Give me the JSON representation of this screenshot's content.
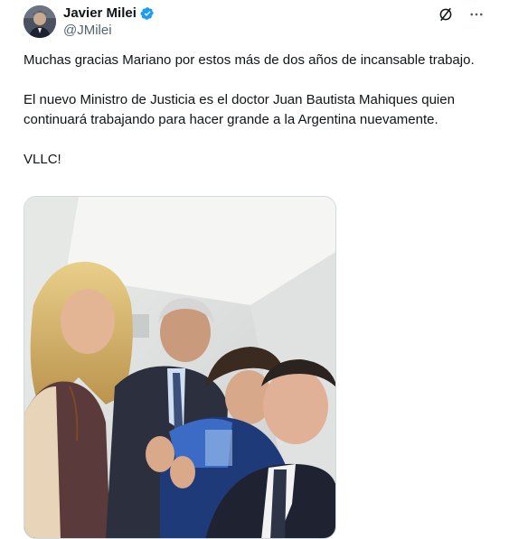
{
  "author": {
    "name": "Javier Milei",
    "handle": "@JMilei",
    "verified": true,
    "avatar_icon": "user-avatar"
  },
  "actions": {
    "grok_icon": "grok-icon",
    "more_icon": "more-options-icon"
  },
  "tweet": {
    "paragraphs": [
      "Muchas gracias Mariano por estos más de dos años de incansable trabajo.",
      "El nuevo Ministro de Justicia es el doctor Juan Bautista Mahiques quien continuará trabajando para hacer grande a la Argentina nuevamente.",
      "VLLC!"
    ]
  },
  "media": {
    "type": "photo",
    "icon": "group-selfie-photo"
  },
  "colors": {
    "text": "#0f1419",
    "secondary": "#536471",
    "verified": "#1d9bf0",
    "border": "#cfd9de"
  }
}
